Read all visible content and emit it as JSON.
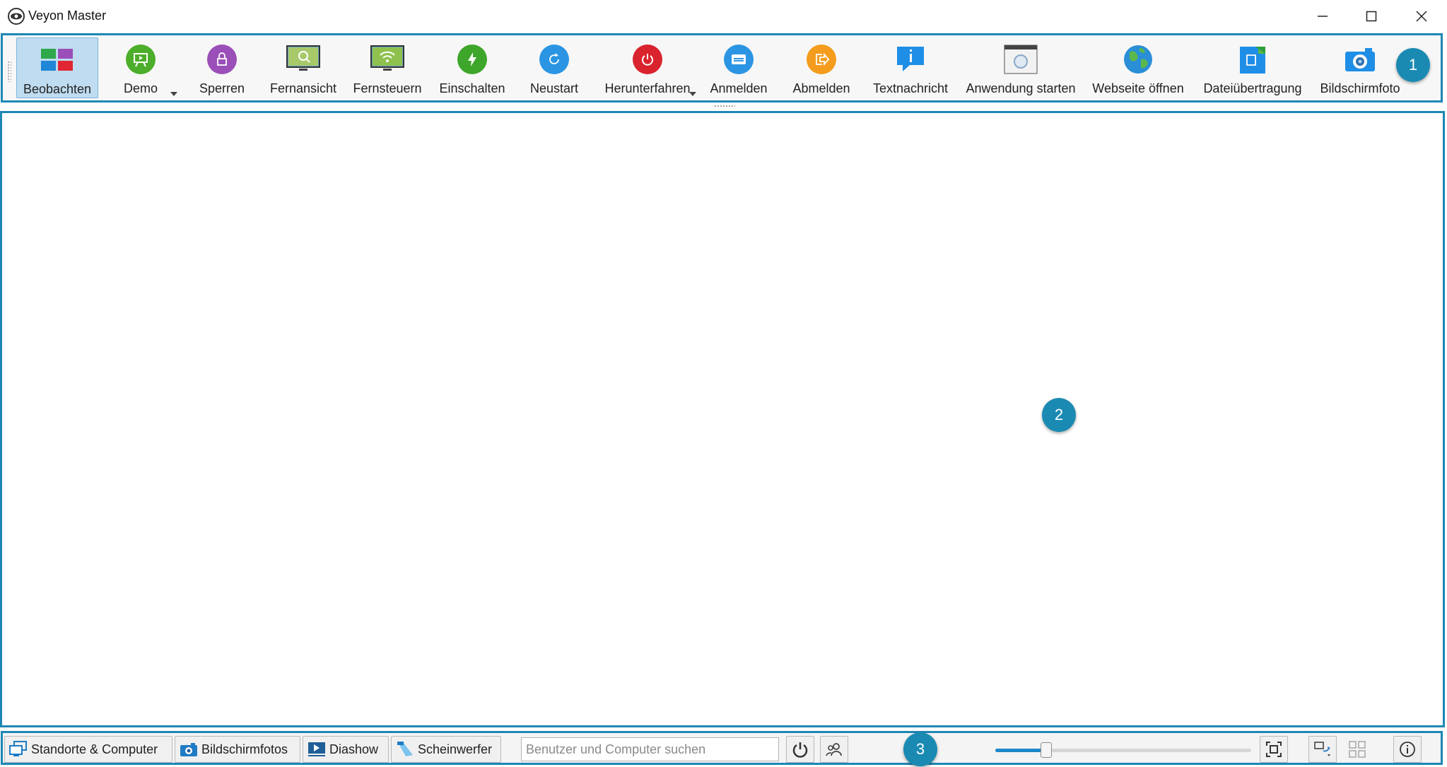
{
  "window": {
    "title": "Veyon Master"
  },
  "toolbar": {
    "buttons": [
      {
        "label": "Beobachten",
        "icon": "monitor-tiles-icon",
        "active": true
      },
      {
        "label": "Demo",
        "icon": "presentation-icon",
        "color": "#4cae2a"
      },
      {
        "label": "Sperren",
        "icon": "lock-icon",
        "color": "#9b4fb8"
      },
      {
        "label": "Fernansicht",
        "icon": "remote-view-icon"
      },
      {
        "label": "Fernsteuern",
        "icon": "remote-control-icon"
      },
      {
        "label": "Einschalten",
        "icon": "power-on-icon",
        "color": "#3ea62a"
      },
      {
        "label": "Neustart",
        "icon": "reboot-icon",
        "color": "#2b95e3"
      },
      {
        "label": "Herunterfahren",
        "icon": "shutdown-icon",
        "color": "#d9232d"
      },
      {
        "label": "Anmelden",
        "icon": "login-icon",
        "color": "#2b95e3"
      },
      {
        "label": "Abmelden",
        "icon": "logout-icon",
        "color": "#f39c1d"
      },
      {
        "label": "Textnachricht",
        "icon": "message-icon",
        "color": "#1f8ee6"
      },
      {
        "label": "Anwendung starten",
        "icon": "application-window-icon"
      },
      {
        "label": "Webseite öffnen",
        "icon": "globe-icon"
      },
      {
        "label": "Dateiübertragung",
        "icon": "file-transfer-icon"
      },
      {
        "label": "Bildschirmfoto",
        "icon": "camera-icon"
      }
    ]
  },
  "annotations": {
    "badge1": "1",
    "badge2": "2",
    "badge3": "3"
  },
  "bottombar": {
    "locations_label": "Standorte & Computer",
    "screenshots_label": "Bildschirmfotos",
    "slideshow_label": "Diashow",
    "spotlight_label": "Scheinwerfer",
    "search_placeholder": "Benutzer und Computer suchen",
    "zoom_level": 0.2
  },
  "colors": {
    "accent": "#1e87b4",
    "badge": "#1a8ab3"
  }
}
